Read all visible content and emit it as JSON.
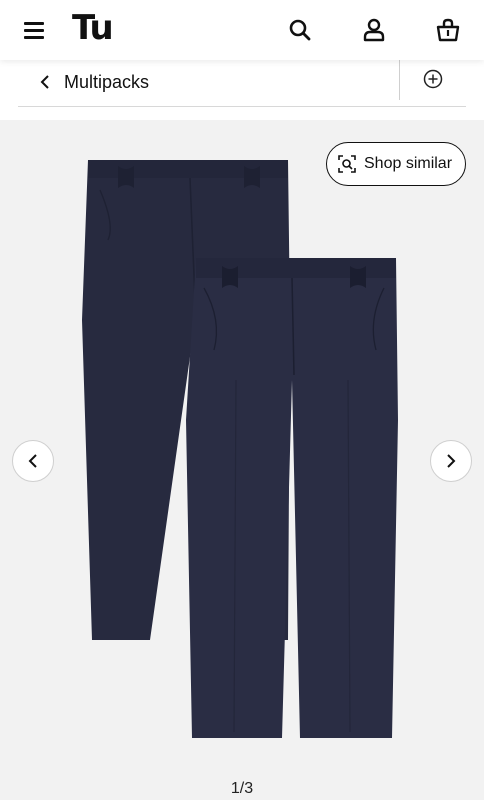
{
  "header": {
    "logo_text": "Tu",
    "icons": [
      "menu-icon",
      "search-icon",
      "account-icon",
      "basket-icon"
    ]
  },
  "breadcrumb": {
    "label": "Multipacks",
    "back_icon": "chevron-left-icon",
    "add_icon": "plus-circle-icon"
  },
  "gallery": {
    "shop_similar_label": "Shop similar",
    "pager": "1/3",
    "image_desc_icon": "product-image"
  },
  "colors": {
    "trouser": "#272a3f",
    "gallery_bg": "#f2f2f2"
  }
}
